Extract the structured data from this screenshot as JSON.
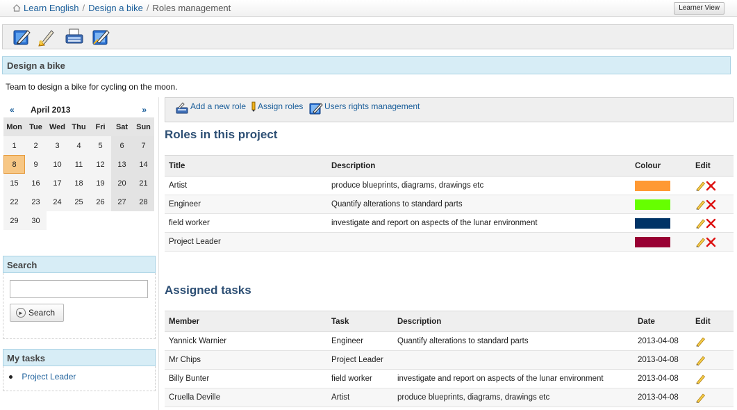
{
  "breadcrumb": {
    "items": [
      "Learn English",
      "Design a bike"
    ],
    "separator": "/",
    "current": "Roles management"
  },
  "learner_view_label": "Learner View",
  "toolbar": {
    "icons": [
      "edit-description-icon",
      "brush-edit-icon",
      "printer-icon",
      "edit-settings-icon"
    ]
  },
  "course": {
    "title": "Design a bike",
    "description": "Team to design a bike for cycling on the moon."
  },
  "calendar": {
    "prev": "«",
    "next": "»",
    "month_label": "April 2013",
    "day_names": [
      "Mon",
      "Tue",
      "Wed",
      "Thu",
      "Fri",
      "Sat",
      "Sun"
    ],
    "days": [
      "1",
      "2",
      "3",
      "4",
      "5",
      "6",
      "7",
      "8",
      "9",
      "10",
      "11",
      "12",
      "13",
      "14",
      "15",
      "16",
      "17",
      "18",
      "19",
      "20",
      "21",
      "22",
      "23",
      "24",
      "25",
      "26",
      "27",
      "28",
      "29",
      "30"
    ],
    "today": "8"
  },
  "search": {
    "title": "Search",
    "placeholder": "",
    "button_label": "Search"
  },
  "my_tasks": {
    "title": "My tasks",
    "items": [
      "Project Leader"
    ]
  },
  "actions": {
    "add_role": "Add a new role",
    "assign_roles": "Assign roles",
    "user_rights": "Users rights management"
  },
  "roles": {
    "heading": "Roles in this project",
    "columns": [
      "Title",
      "Description",
      "Colour",
      "Edit"
    ],
    "rows": [
      {
        "title": "Artist",
        "description": "produce blueprints, diagrams, drawings etc",
        "colour": "#ff9933"
      },
      {
        "title": "Engineer",
        "description": "Quantify alterations to standard parts",
        "colour": "#66ff00"
      },
      {
        "title": "field worker",
        "description": "investigate and report on aspects of the lunar environment",
        "colour": "#003366"
      },
      {
        "title": "Project Leader",
        "description": "",
        "colour": "#990033"
      }
    ]
  },
  "assigned": {
    "heading": "Assigned tasks",
    "columns": [
      "Member",
      "Task",
      "Description",
      "Date",
      "Edit"
    ],
    "rows": [
      {
        "member": "Yannick Warnier",
        "task": "Engineer",
        "description": "Quantify alterations to standard parts",
        "date": "2013-04-08"
      },
      {
        "member": "Mr Chips",
        "task": "Project Leader",
        "description": "",
        "date": "2013-04-08"
      },
      {
        "member": "Billy Bunter",
        "task": "field worker",
        "description": "investigate and report on aspects of the lunar environment",
        "date": "2013-04-08"
      },
      {
        "member": "Cruella Deville",
        "task": "Artist",
        "description": "produce blueprints, diagrams, drawings etc",
        "date": "2013-04-08"
      }
    ]
  }
}
